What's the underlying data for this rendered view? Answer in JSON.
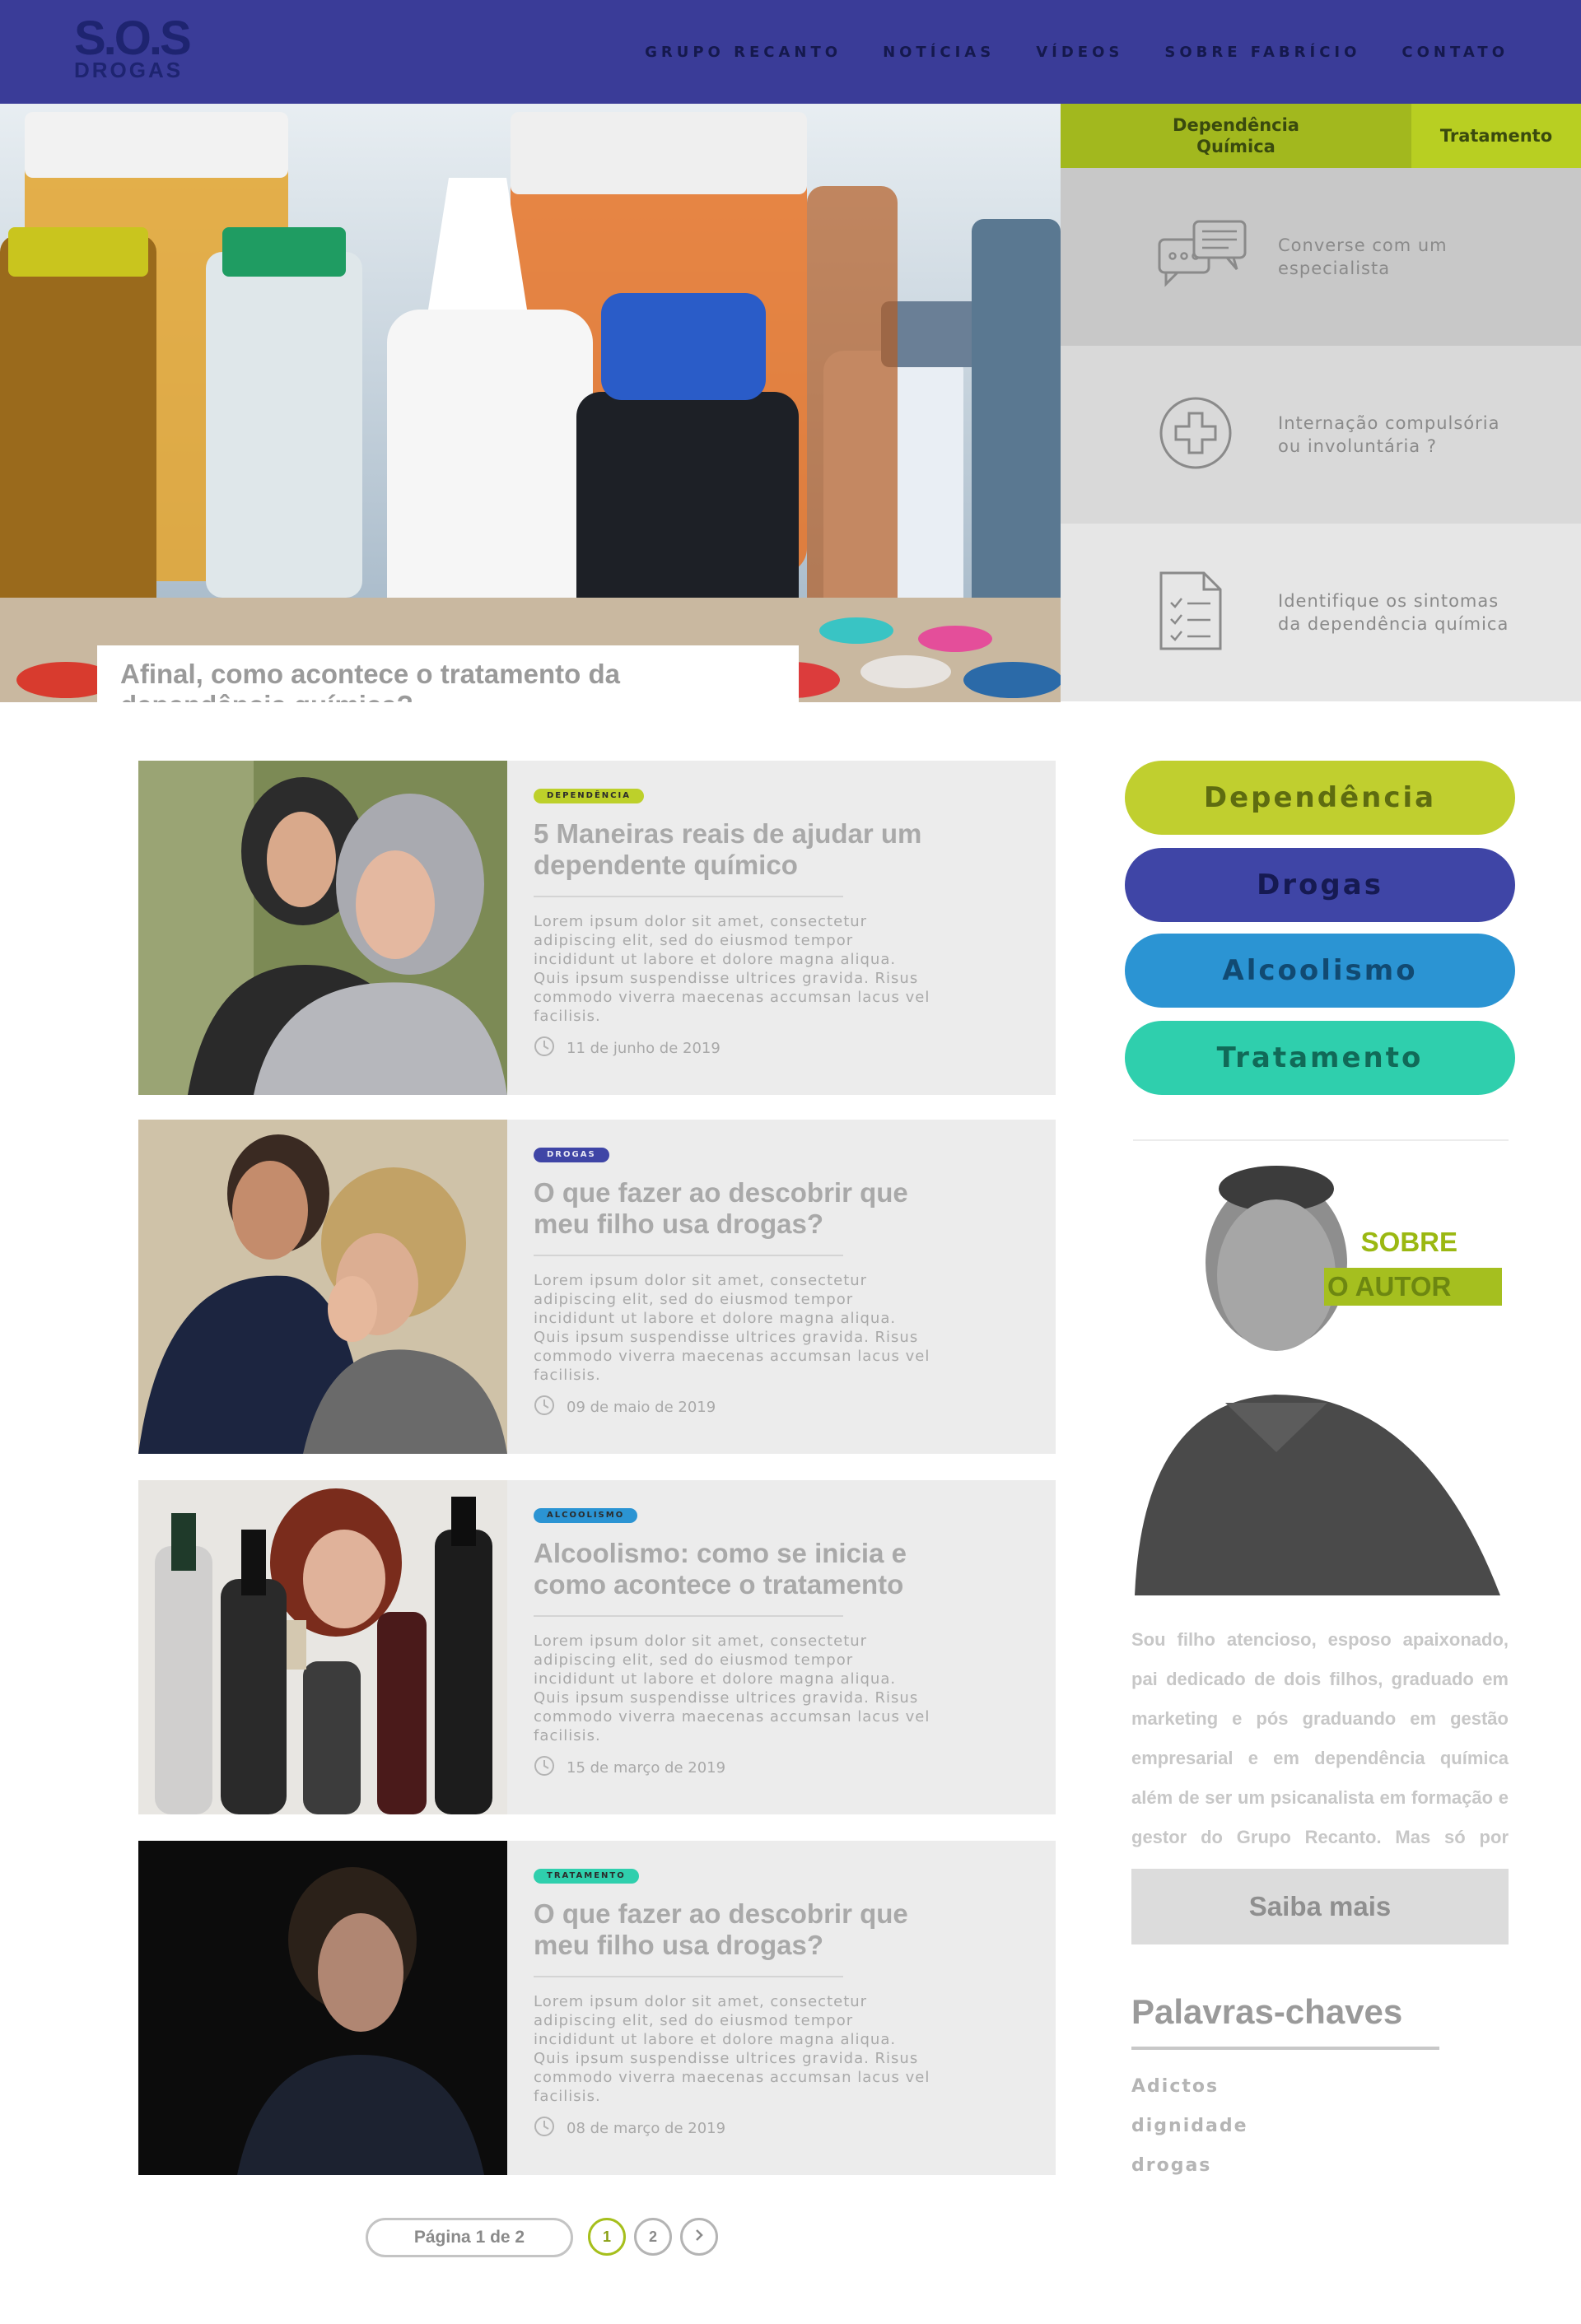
{
  "brand": {
    "logo_top": "S.O.S",
    "logo_bottom": "DROGAS"
  },
  "nav": [
    {
      "label": "GRUPO RECANTO"
    },
    {
      "label": "NOTÍCIAS"
    },
    {
      "label": "VÍDEOS"
    },
    {
      "label": "SOBRE FABRÍCIO"
    },
    {
      "label": "CONTATO"
    }
  ],
  "hero": {
    "caption": "Afinal, como acontece o tratamento da dependência química?"
  },
  "hero_side": {
    "tabs": [
      {
        "label": "Dependência Química"
      },
      {
        "label": "Tratamento"
      }
    ],
    "boxes": [
      {
        "label": "Converse com um especialista",
        "icon": "chat-bubbles-icon"
      },
      {
        "label": "Internação compulsória ou involuntária ?",
        "icon": "medical-cross-icon"
      },
      {
        "label": "Identifique os sintomas da dependência química",
        "icon": "checklist-icon"
      }
    ]
  },
  "posts": [
    {
      "category": "DEPENDÊNCIA",
      "title": "5 Maneiras reais de ajudar um dependente químico",
      "excerpt": "Lorem ipsum dolor sit amet, consectetur adipiscing elit, sed do eiusmod tempor incididunt ut labore et dolore magna aliqua. Quis ipsum suspendisse ultrices gravida. Risus commodo viverra maecenas accumsan lacus vel facilisis.",
      "date": "11 de junho de 2019"
    },
    {
      "category": "DROGAS",
      "title": "O que fazer ao descobrir que meu filho usa drogas?",
      "excerpt": "Lorem ipsum dolor sit amet, consectetur adipiscing elit, sed do eiusmod tempor incididunt ut labore et dolore magna aliqua. Quis ipsum suspendisse ultrices gravida. Risus commodo viverra maecenas accumsan lacus vel facilisis.",
      "date": "09 de maio de 2019"
    },
    {
      "category": "ALCOOLISMO",
      "title": "Alcoolismo: como se inicia e como acontece o tratamento",
      "excerpt": "Lorem ipsum dolor sit amet, consectetur adipiscing elit, sed do eiusmod tempor incididunt ut labore et dolore magna aliqua. Quis ipsum suspendisse ultrices gravida. Risus commodo viverra maecenas accumsan lacus vel facilisis.",
      "date": "15 de março de 2019"
    },
    {
      "category": "TRATAMENTO",
      "title": "O que fazer ao descobrir que meu filho usa drogas?",
      "excerpt": "Lorem ipsum dolor sit amet, consectetur adipiscing elit, sed do eiusmod tempor incididunt ut labore et dolore magna aliqua. Quis ipsum suspendisse ultrices gravida. Risus commodo viverra maecenas accumsan lacus vel facilisis.",
      "date": "08 de março de 2019"
    }
  ],
  "categories": [
    {
      "label": "Dependência",
      "color": "#c0cf2f"
    },
    {
      "label": "Drogas",
      "color": "#3f45a6"
    },
    {
      "label": "Alcoolismo",
      "color": "#2b94d3"
    },
    {
      "label": "Tratamento",
      "color": "#2fcfad"
    }
  ],
  "author": {
    "heading_1": "SOBRE",
    "heading_2": "O AUTOR",
    "bio": "Sou filho atencioso, esposo apaixonado, pai dedicado de dois filhos, graduado em marketing e pós graduando em gestão empresarial e em dependência química além de ser um psicanalista em formação e gestor do Grupo Recanto. Mas só por hoje...",
    "button": "Saiba mais"
  },
  "keywords": {
    "title": "Palavras-chaves",
    "items": [
      "Adictos",
      "dignidade",
      "drogas"
    ]
  },
  "pagination": {
    "info": "Página 1 de 2",
    "pages": [
      "1",
      "2"
    ],
    "current": "1",
    "next_icon": "chevron-right-icon"
  },
  "colors": {
    "header": "#3a3c98",
    "accent_green": "#a6bf1c",
    "post_bg": "#ececec"
  }
}
